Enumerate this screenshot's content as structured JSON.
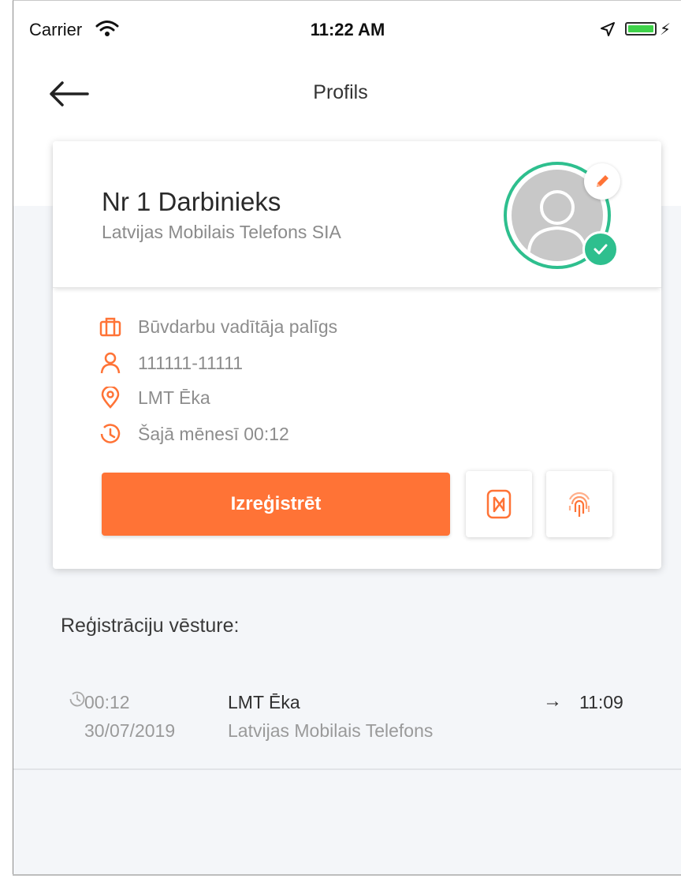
{
  "status_bar": {
    "carrier": "Carrier",
    "time": "11:22 AM"
  },
  "nav": {
    "title": "Profils"
  },
  "profile": {
    "name": "Nr 1 Darbinieks",
    "company": "Latvijas Mobilais Telefons SIA",
    "verified": true,
    "details": [
      {
        "icon": "briefcase-icon",
        "text": "Būvdarbu vadītāja palīgs"
      },
      {
        "icon": "person-icon",
        "text": "111111-11111"
      },
      {
        "icon": "location-pin-icon",
        "text": "LMT Ēka"
      },
      {
        "icon": "clock-icon",
        "text": "Šajā mēnesī 00:12"
      }
    ],
    "checkout_label": "Izreģistrēt"
  },
  "history": {
    "title": "Reģistrāciju vēsture:",
    "items": [
      {
        "duration": "00:12",
        "date": "30/07/2019",
        "place": "LMT Ēka",
        "company": "Latvijas Mobilais Telefons",
        "time": "11:09"
      }
    ]
  },
  "colors": {
    "accent": "#ff7336",
    "success": "#2ebf8e",
    "battery": "#3fd24a",
    "background": "#f4f6f9"
  }
}
